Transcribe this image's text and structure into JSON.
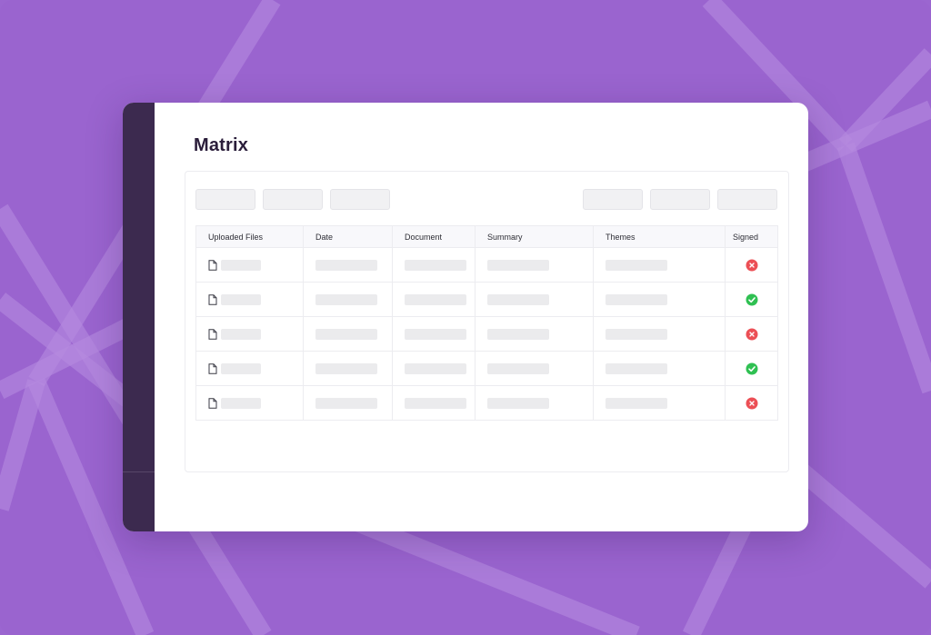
{
  "page": {
    "title": "Matrix"
  },
  "table": {
    "columns": [
      "Uploaded Files",
      "Date",
      "Document",
      "Summary",
      "Themes",
      "Signed"
    ],
    "rows": [
      {
        "signed": "cross",
        "signed_icon": "x-circle-icon"
      },
      {
        "signed": "check",
        "signed_icon": "check-circle-icon"
      },
      {
        "signed": "cross",
        "signed_icon": "x-circle-icon"
      },
      {
        "signed": "check",
        "signed_icon": "check-circle-icon"
      },
      {
        "signed": "cross",
        "signed_icon": "x-circle-icon"
      }
    ]
  },
  "icons": {
    "file": "file-icon",
    "signed_yes": "check-circle-icon",
    "signed_no": "x-circle-icon"
  },
  "colors": {
    "background": "#9a64cf",
    "sidebar": "#3c2a4f",
    "signed_yes": "#2fc052",
    "signed_no": "#ec4f55"
  }
}
